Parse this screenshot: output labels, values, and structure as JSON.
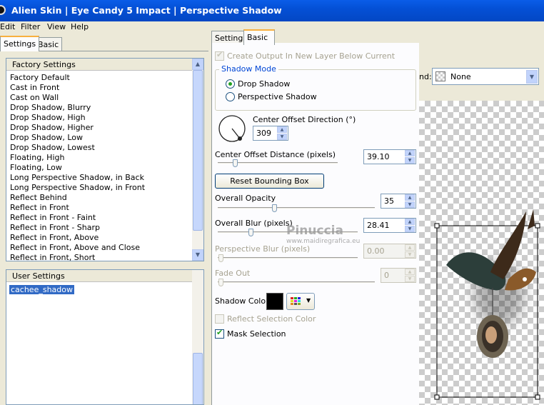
{
  "window": {
    "title": "Alien Skin  |  Eye Candy 5 Impact  |  Perspective Shadow"
  },
  "menu": [
    "Edit",
    "Filter",
    "View",
    "Help"
  ],
  "left_tabs": [
    "Settings",
    "Basic"
  ],
  "factory": {
    "header": "Factory Settings",
    "items": [
      "Factory Default",
      "Cast in Front",
      "Cast on Wall",
      "Drop Shadow, Blurry",
      "Drop Shadow, High",
      "Drop Shadow, Higher",
      "Drop Shadow, Low",
      "Drop Shadow, Lowest",
      "Floating, High",
      "Floating, Low",
      "Long Perspective Shadow, in Back",
      "Long Perspective Shadow, in Front",
      "Reflect Behind",
      "Reflect in Front",
      "Reflect in Front - Faint",
      "Reflect in Front - Sharp",
      "Reflect in Front, Above",
      "Reflect in Front, Above and Close",
      "Reflect in Front, Short"
    ]
  },
  "user": {
    "header": "User Settings",
    "items": [
      "cachee_shadow"
    ]
  },
  "panel_tabs": [
    "Settings",
    "Basic"
  ],
  "basic": {
    "create_output": "Create Output In New Layer Below Current",
    "shadow_mode": {
      "title": "Shadow Mode",
      "options": [
        "Drop Shadow",
        "Perspective Shadow"
      ],
      "selected": "Drop Shadow"
    },
    "direction": {
      "label": "Center Offset Direction (°)",
      "value": "309"
    },
    "distance": {
      "label": "Center Offset Distance (pixels)",
      "value": "39.10"
    },
    "reset_button": "Reset Bounding Box",
    "opacity": {
      "label": "Overall Opacity",
      "value": "35"
    },
    "blur": {
      "label": "Overall Blur (pixels)",
      "value": "28.41"
    },
    "persp_blur": {
      "label": "Perspective Blur (pixels)",
      "value": "0.00"
    },
    "fade": {
      "label": "Fade Out",
      "value": "0"
    },
    "shadow_color": {
      "label": "Shadow Color",
      "color": "#000000"
    },
    "reflect": "Reflect Selection Color",
    "mask": "Mask Selection"
  },
  "watermark": {
    "name": "Pinuccia",
    "url": "www.maidiregrafica.eu"
  },
  "background": {
    "label": "nd:",
    "value": "None"
  },
  "icons": [
    "scroll-up-arrow",
    "scroll-down-arrow",
    "direction-dial-icon",
    "color-palette-icon",
    "dropdown-arrow-icon",
    "checker-swatch-icon"
  ]
}
